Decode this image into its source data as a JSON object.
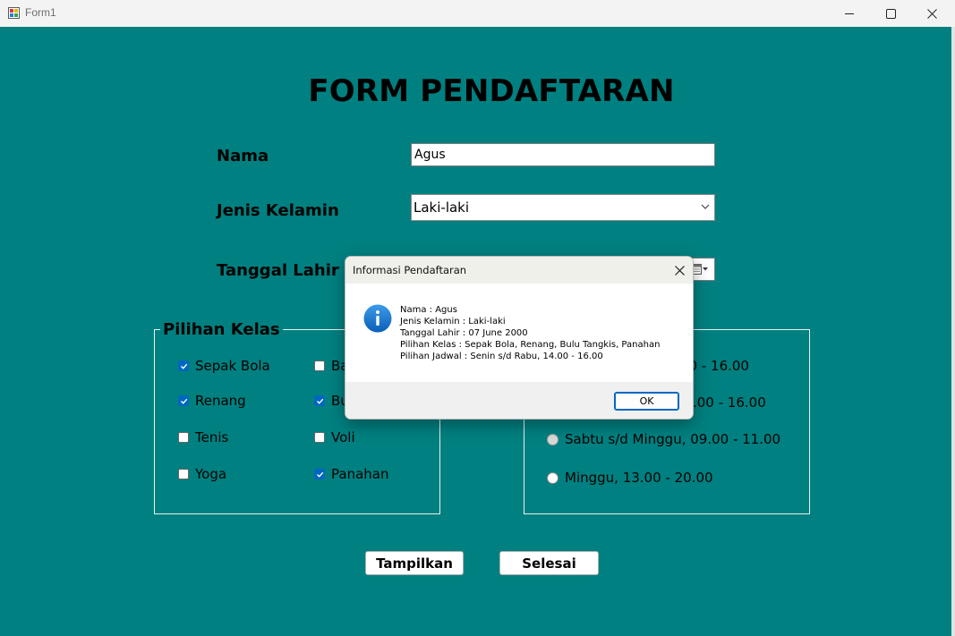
{
  "window": {
    "title": "Form1"
  },
  "form": {
    "heading": "FORM PENDAFTARAN",
    "nama_label": "Nama",
    "nama_value": "Agus",
    "jenis_kelamin_label": "Jenis Kelamin",
    "jenis_kelamin_value": "Laki-laki",
    "tanggal_lahir_label": "Tanggal Lahir"
  },
  "kelas": {
    "title": "Pilihan Kelas",
    "items": [
      {
        "label": "Sepak Bola",
        "checked": true
      },
      {
        "label": "Ba",
        "checked": false
      },
      {
        "label": "Renang",
        "checked": true
      },
      {
        "label": "Bu",
        "checked": true
      },
      {
        "label": "Tenis",
        "checked": false
      },
      {
        "label": "Voli",
        "checked": false
      },
      {
        "label": "Yoga",
        "checked": false
      },
      {
        "label": "Panahan",
        "checked": true
      }
    ]
  },
  "jadwal": {
    "items": [
      {
        "label": "00 - 16.00"
      },
      {
        "label": ".00 - 16.00"
      },
      {
        "label": "Sabtu s/d Minggu, 09.00 - 11.00"
      },
      {
        "label": "Minggu, 13.00 - 20.00"
      }
    ]
  },
  "buttons": {
    "tampilkan": "Tampilkan",
    "selesai": "Selesai"
  },
  "dialog": {
    "title": "Informasi Pendaftaran",
    "lines": [
      "Nama : Agus",
      "Jenis Kelamin : Laki-laki",
      "Tanggal Lahir : 07 June 2000",
      "Pilihan Kelas : Sepak Bola, Renang, Bulu Tangkis, Panahan",
      "Pilihan Jadwal : Senin s/d Rabu, 14.00 - 16.00"
    ],
    "ok_label": "OK",
    "icon": "info-icon"
  },
  "colors": {
    "background": "#008080",
    "accent": "#0067c0"
  }
}
